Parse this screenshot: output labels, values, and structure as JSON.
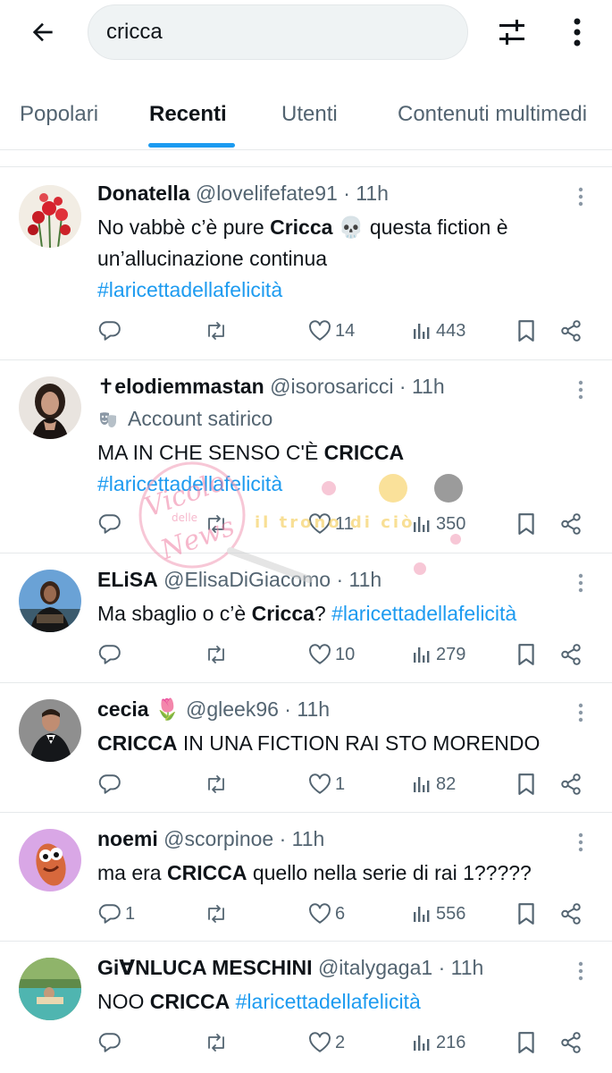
{
  "search": {
    "query": "cricca"
  },
  "tabs": [
    "Popolari",
    "Recenti",
    "Utenti",
    "Contenuti multimedi"
  ],
  "tweets": [
    {
      "name": "Donatella",
      "handle": "@lovelifefate91",
      "time": "11h",
      "text_before": "No vabbè c’è pure ",
      "bold": "Cricca",
      "text_after": " 💀 questa fiction è un’allucinazione continua",
      "hashtag": "#laricettadellafelicità",
      "replies": "",
      "likes": "14",
      "views": "443"
    },
    {
      "name": "✝elodiemmastan",
      "handle": "@isorosaricci",
      "time": "11h",
      "badge": "Account satirico",
      "text_before": "MA IN CHE SENSO C'È ",
      "bold": "CRICCA",
      "text_after": "",
      "hashtag": "#laricettadellafelicità",
      "replies": "",
      "likes": "11",
      "views": "350"
    },
    {
      "name": "ELiSA",
      "handle": "@ElisaDiGiacomo",
      "time": "11h",
      "text_before": "Ma sbaglio o c’è ",
      "bold": "Cricca",
      "text_after": "? ",
      "hashtag": "#laricettadellafelicità",
      "replies": "",
      "likes": "10",
      "views": "279"
    },
    {
      "name": "cecia 🌷",
      "handle": "@gleek96",
      "time": "11h",
      "text_before": "",
      "bold": "CRICCA",
      "text_after": " IN UNA FICTION RAI STO MORENDO",
      "hashtag": "",
      "replies": "",
      "likes": "1",
      "views": "82"
    },
    {
      "name": "noemi",
      "handle": "@scorpinoe",
      "time": "11h",
      "text_before": "ma era ",
      "bold": "CRICCA",
      "text_after": " quello nella serie di rai 1?????",
      "hashtag": "",
      "replies": "1",
      "likes": "6",
      "views": "556"
    },
    {
      "name": "GiꓯNLUCA MESCHINI",
      "handle": "@italygaga1",
      "time": "11h",
      "text_before": "NOO ",
      "bold": "CRICCA",
      "text_after": " ",
      "hashtag": "#laricettadellafelicità",
      "replies": "",
      "likes": "2",
      "views": "216"
    }
  ],
  "watermark": {
    "text1": "Vicolo delle News",
    "text2": "Il Trono di Ciò"
  },
  "icons": {
    "back": "arrow-left-icon",
    "filter": "sliders-icon",
    "more": "more-vertical-icon",
    "reply": "reply-icon",
    "retweet": "retweet-icon",
    "like": "heart-icon",
    "views": "views-icon",
    "bookmark": "bookmark-icon",
    "share": "share-icon"
  },
  "colors": {
    "accent": "#1d9bf0",
    "secondary_text": "#536471",
    "primary_text": "#0f1419"
  }
}
